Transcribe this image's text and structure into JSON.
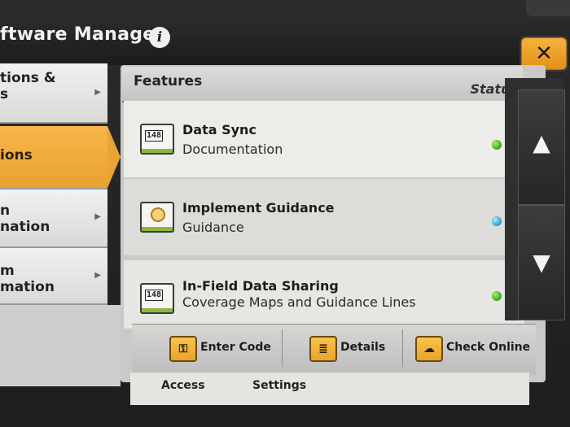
{
  "window": {
    "title": "ftware Manager",
    "close_glyph": "✕"
  },
  "sidebar": {
    "items": [
      {
        "label": "tions &\ns",
        "active": false
      },
      {
        "label": "ions",
        "active": true
      },
      {
        "label": "n\nnation",
        "active": false
      },
      {
        "label": "m\nmation",
        "active": false
      }
    ],
    "arrow_glyph": "▶"
  },
  "table": {
    "header_features": "Features",
    "header_status": "Status",
    "rows": [
      {
        "title": "Data Sync",
        "subtitle": "Documentation",
        "icon": "counter-icon",
        "counter": "148",
        "status_color": "#43b02a"
      },
      {
        "title": "Implement Guidance",
        "subtitle": "Guidance",
        "icon": "target-icon",
        "status_color": "#3aa6e0"
      },
      {
        "title": "In-Field Data Sharing",
        "subtitle": "Coverage Maps and Guidance Lines",
        "icon": "counter-icon",
        "counter": "148",
        "status_color": "#43b02a"
      }
    ]
  },
  "scroll": {
    "up_glyph": "▲",
    "down_glyph": "▼"
  },
  "actions": {
    "enter_code": "Enter Code",
    "details": "Details",
    "check_online": "Check Online",
    "key_glyph": "⚿",
    "doc_glyph": "≣",
    "cloud_glyph": "☁"
  },
  "background_labels": {
    "left": "Access",
    "right": "Settings"
  },
  "colors": {
    "accent": "#eba432",
    "status_green": "#43b02a",
    "status_blue": "#3aa6e0"
  }
}
